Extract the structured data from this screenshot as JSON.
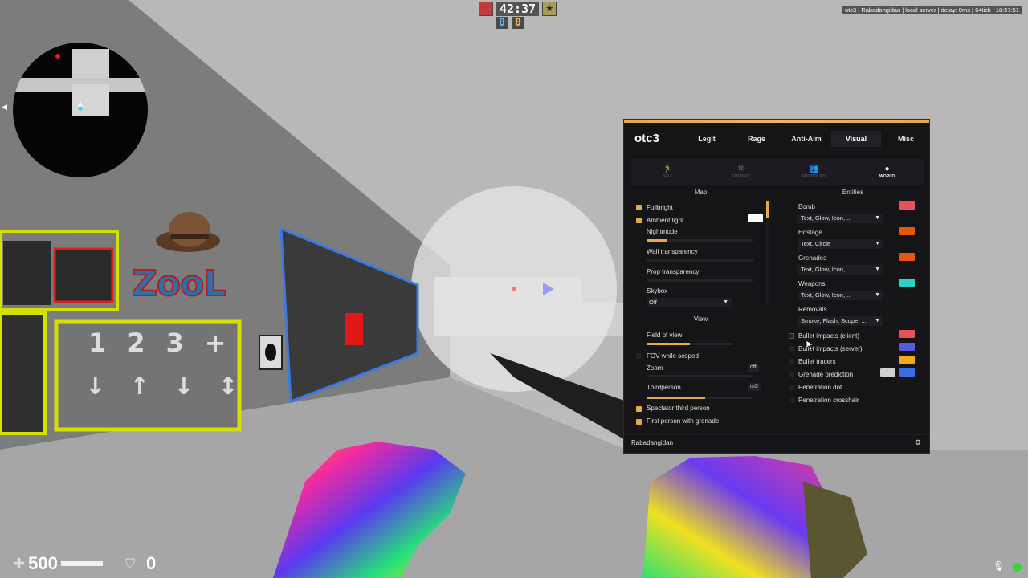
{
  "hud": {
    "timer": "42:37",
    "score_ct": "0",
    "score_t": "0",
    "server_info": "otc3 | Rabadangidan | local server | delay: 0ms | 64tick | 18:57:51",
    "health": "500",
    "armor": "0",
    "colors": {
      "ct": "#6fb6ff",
      "t": "#f2c14a",
      "rec": "#3cd23c"
    }
  },
  "scene": {
    "wall_logo_text": "ZooL",
    "keypad_digits": [
      "1",
      "2",
      "3",
      "+"
    ],
    "arrows": [
      "↓",
      "↑",
      "↓",
      "↕"
    ]
  },
  "menu": {
    "title": "otc3",
    "tabs": [
      "Legit",
      "Rage",
      "Anti-Aim",
      "Visual",
      "Misc"
    ],
    "active_tab": "Visual",
    "subtabs": [
      {
        "label": "SELF",
        "icon": "person-icon"
      },
      {
        "label": "ENEMIES",
        "icon": "enemies-icon"
      },
      {
        "label": "FRIENDLIES",
        "icon": "friendlies-icon"
      },
      {
        "label": "WORLD",
        "icon": "globe-icon"
      }
    ],
    "active_subtab": "WORLD",
    "map": {
      "title": "Map",
      "fullbright": {
        "label": "Fullbright",
        "checked": true
      },
      "ambient_light": {
        "label": "Ambient light",
        "checked": true,
        "color": "#ffffff"
      },
      "nightmode": {
        "label": "Nightmode",
        "value": 0.2
      },
      "wall_transparency": {
        "label": "Wall transparency",
        "value": 0.0
      },
      "prop_transparency": {
        "label": "Prop transparency",
        "value": 0.0
      },
      "skybox": {
        "label": "Skybox",
        "value": "Off"
      }
    },
    "view": {
      "title": "View",
      "field_of_view": {
        "label": "Field of view",
        "value": 0.5
      },
      "fov_while_scoped": {
        "label": "FOV while scoped",
        "checked": false
      },
      "zoom": {
        "label": "Zoom",
        "key": "off",
        "value": 0.0
      },
      "thirdperson": {
        "label": "Thirdperson",
        "key": "m3",
        "value": 0.55
      },
      "spectator_third_person": {
        "label": "Spectator third person",
        "checked": true
      },
      "first_person_grenade": {
        "label": "First person with grenade",
        "checked": true
      }
    },
    "entities": {
      "title": "Entities",
      "bomb": {
        "label": "Bomb",
        "value": "Text, Glow, Icon, ...",
        "color": "#e8505a"
      },
      "hostage": {
        "label": "Hostage",
        "value": "Text, Circle",
        "color": "#e8560c"
      },
      "grenades": {
        "label": "Grenades",
        "value": "Text, Glow, Icon, ...",
        "color": "#e8560c"
      },
      "weapons": {
        "label": "Weapons",
        "value": "Text, Glow, Icon, ...",
        "color": "#2ed1c8"
      },
      "removals": {
        "label": "Removals",
        "value": "Smoke, Flash, Scope, ..."
      },
      "bullet_impacts_client": {
        "label": "Bullet impacts (client)",
        "checked": false,
        "color": "#e8505a"
      },
      "bullet_impacts_server": {
        "label": "Bullet impacts (server)",
        "checked": false,
        "color": "#5858e8"
      },
      "bullet_tracers": {
        "label": "Bullet tracers",
        "checked": false,
        "color": "#f2a81a"
      },
      "grenade_prediction": {
        "label": "Grenade prediction",
        "checked": false,
        "color": "#3a6ee0",
        "color2": "#d0d0d0"
      },
      "penetration_dot": {
        "label": "Penetration dot",
        "checked": false
      },
      "penetration_crosshair": {
        "label": "Penetration crosshair",
        "checked": false
      }
    },
    "footer_user": "Rabadangidan",
    "accent": "#e8a84a"
  }
}
